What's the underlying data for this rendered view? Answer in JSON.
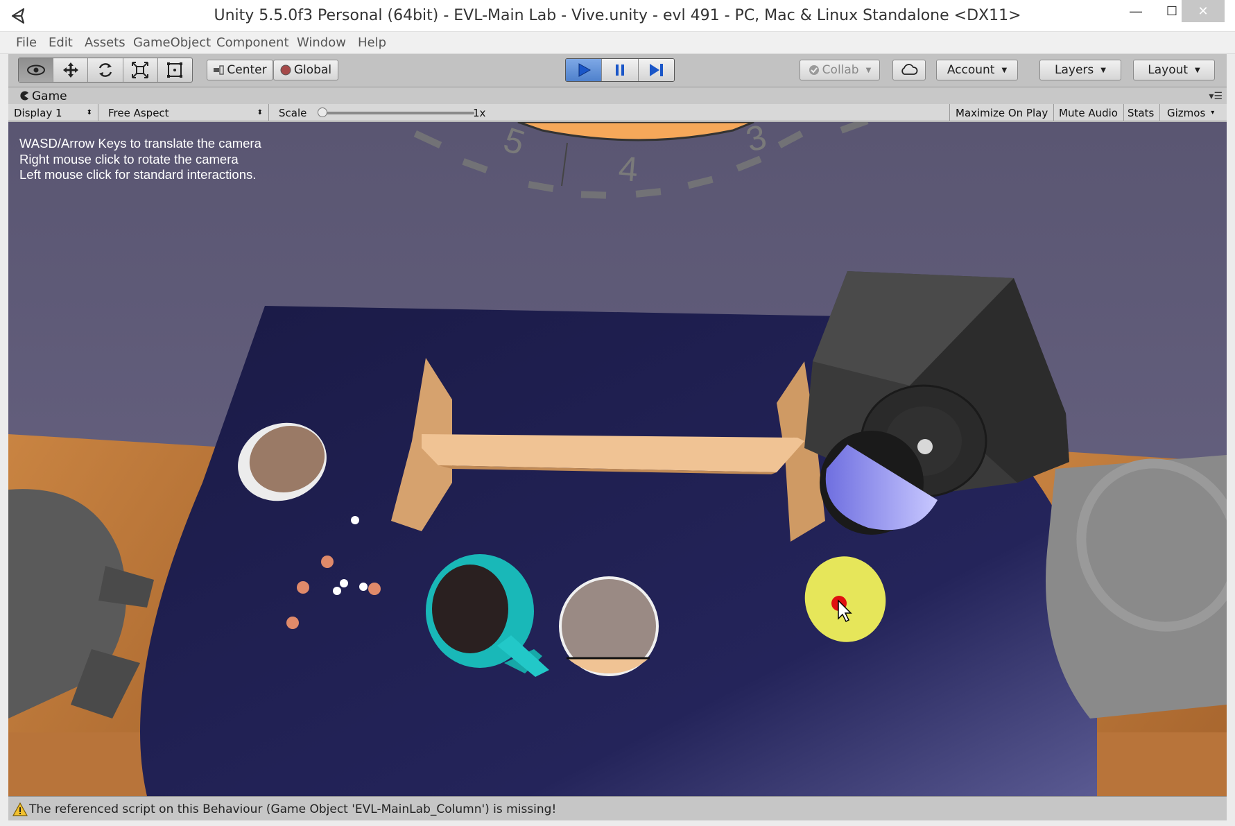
{
  "window": {
    "title": "Unity 5.5.0f3 Personal (64bit) - EVL-Main Lab - Vive.unity - evl 491 - PC, Mac & Linux Standalone <DX11>",
    "controls": {
      "minimize": "—",
      "maximize": "☐",
      "close": "✕"
    }
  },
  "menu": {
    "items": [
      "File",
      "Edit",
      "Assets",
      "GameObject",
      "Component",
      "Window",
      "Help"
    ]
  },
  "toolbar": {
    "tools": [
      {
        "icon": "eye-icon",
        "active": true
      },
      {
        "icon": "move-icon",
        "active": false
      },
      {
        "icon": "rotate-icon",
        "active": false
      },
      {
        "icon": "scale-icon",
        "active": false
      },
      {
        "icon": "rect-tool-icon",
        "active": false
      }
    ],
    "pivot_label": "Center",
    "space_label": "Global",
    "play": {
      "playing": true,
      "paused": false
    },
    "collab_label": "Collab",
    "account_label": "Account",
    "layers_label": "Layers",
    "layout_label": "Layout"
  },
  "game_view": {
    "tab_label": "Game",
    "display": "Display 1",
    "aspect": "Free Aspect",
    "scale_label": "Scale",
    "scale_value": "1x",
    "maximize_on_play": "Maximize On Play",
    "mute_audio": "Mute Audio",
    "stats": "Stats",
    "gizmos": "Gizmos",
    "help_lines": [
      "WASD/Arrow Keys to translate the camera",
      "Right mouse click to rotate the camera",
      "Left mouse click for standard interactions."
    ],
    "clock_numerals": [
      "5",
      "4",
      "3"
    ]
  },
  "status": {
    "icon": "warning-icon",
    "message": "The referenced script on this Behaviour (Game Object 'EVL-MainLab_Column') is missing!"
  },
  "colors": {
    "wall": "#5f5a78",
    "table": "#1f1f52",
    "floor_wood": "#c07a3c",
    "board": "#e8b888",
    "cylinder_blue": "#8080ff",
    "ring_cyan": "#19b8b8",
    "yellow_disc": "#e8e85a",
    "play_active": "#4f81cc"
  }
}
